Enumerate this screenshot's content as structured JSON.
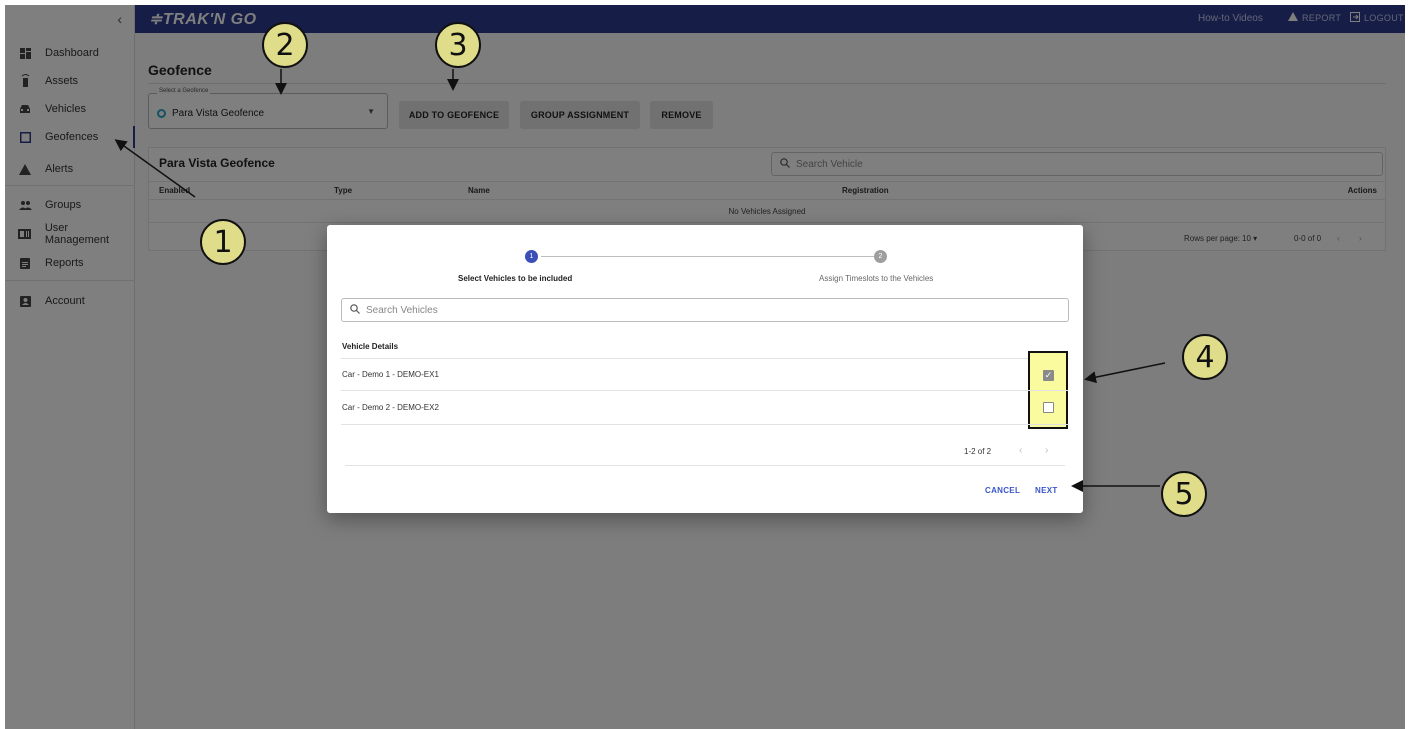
{
  "header": {
    "logo": "≑TRAK'N GO",
    "howto": "How-to Videos",
    "report": "REPORT",
    "logout": "LOGOUT"
  },
  "sidebar": {
    "collapse": "‹",
    "items": [
      {
        "label": "Dashboard",
        "icon": "dashboard-icon"
      },
      {
        "label": "Assets",
        "icon": "asset-tracker-icon"
      },
      {
        "label": "Vehicles",
        "icon": "car-icon"
      },
      {
        "label": "Geofences",
        "icon": "square-outline-icon"
      },
      {
        "label": "Alerts",
        "icon": "warning-icon"
      },
      {
        "label": "Groups",
        "icon": "people-icon"
      },
      {
        "label": "User Management",
        "icon": "id-card-icon"
      },
      {
        "label": "Reports",
        "icon": "clipboard-icon"
      },
      {
        "label": "Account",
        "icon": "account-box-icon"
      }
    ]
  },
  "main": {
    "title": "Geofence",
    "select": {
      "label": "Select a Geofence",
      "value": "Para Vista Geofence"
    },
    "buttons": {
      "add": "ADD TO GEOFENCE",
      "group": "GROUP ASSIGNMENT",
      "remove": "REMOVE"
    },
    "table": {
      "title": "Para Vista Geofence",
      "search_placeholder": "Search Vehicle",
      "columns": {
        "enabled": "Enabled",
        "type": "Type",
        "name": "Name",
        "registration": "Registration",
        "actions": "Actions"
      },
      "empty": "No Vehicles Assigned",
      "rows_per_page_label": "Rows per page:",
      "rows_per_page": "10",
      "range": "0-0 of 0"
    }
  },
  "dialog": {
    "steps": [
      {
        "number": "1",
        "label": "Select Vehicles to be included"
      },
      {
        "number": "2",
        "label": "Assign Timeslots to the Vehicles"
      }
    ],
    "search_placeholder": "Search Vehicles",
    "column": "Vehicle Details",
    "rows": [
      {
        "label": "Car - Demo 1 - DEMO-EX1",
        "checked": true
      },
      {
        "label": "Car - Demo 2 - DEMO-EX2",
        "checked": false
      }
    ],
    "pagination": "1-2 of 2",
    "cancel": "CANCEL",
    "next": "NEXT"
  },
  "annotations": [
    "1",
    "2",
    "3",
    "4",
    "5"
  ],
  "colors": {
    "brand": "#2d3a8c",
    "accent": "#3a55c8",
    "annotation": "#dfdd8a",
    "highlight": "#fafa9e"
  }
}
